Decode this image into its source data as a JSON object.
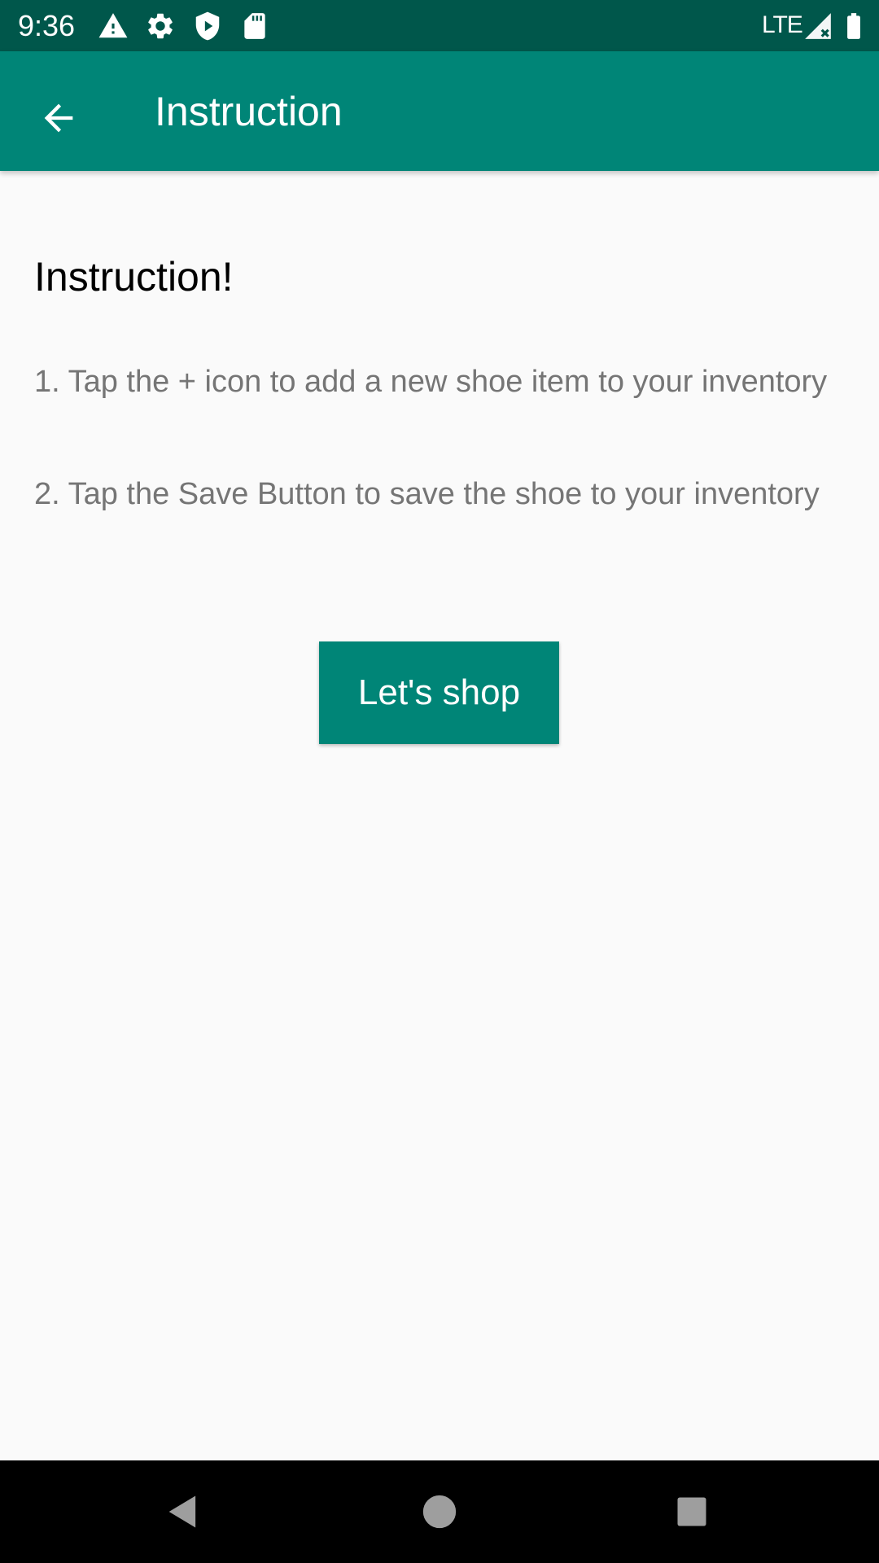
{
  "status_bar": {
    "time": "9:36",
    "network": "LTE",
    "icons": [
      "warning-icon",
      "gear-icon",
      "shield-play-icon",
      "sd-card-icon",
      "signal-icon",
      "battery-icon"
    ]
  },
  "app_bar": {
    "title": "Instruction",
    "back_icon": "arrow-left-icon"
  },
  "content": {
    "heading": "Instruction!",
    "steps": [
      "1. Tap the + icon to add a new shoe item to your inventory",
      "2. Tap the Save Button to save the shoe to your inventory"
    ],
    "button_label": "Let's shop"
  },
  "nav_bar": {
    "icons": [
      "back-triangle-icon",
      "home-circle-icon",
      "recents-square-icon"
    ]
  },
  "colors": {
    "status_bar": "#00574B",
    "primary": "#008577",
    "background": "#FAFAFA",
    "secondary_text": "#757575"
  }
}
